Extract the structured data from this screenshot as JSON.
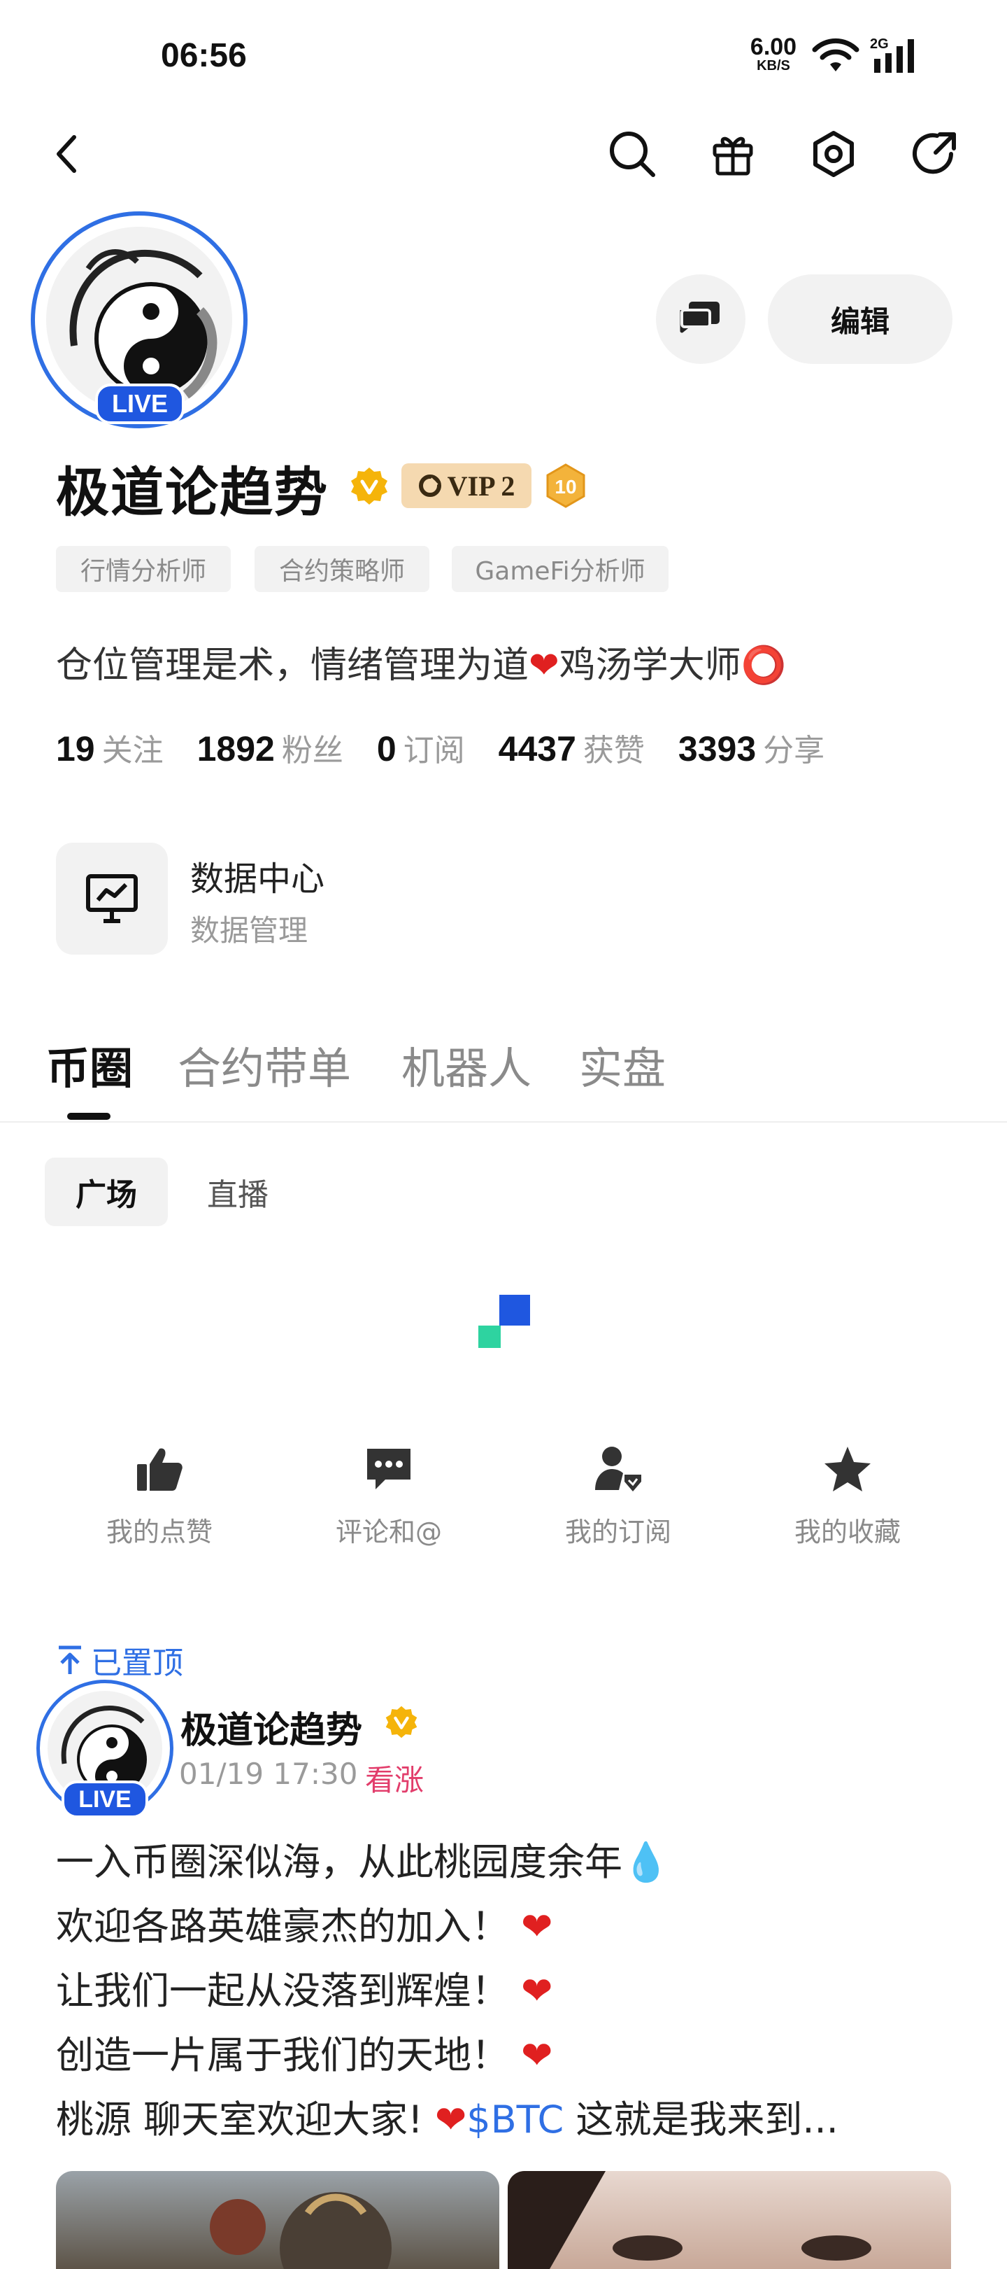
{
  "status_bar": {
    "time": "06:56",
    "net_speed_value": "6.00",
    "net_speed_unit": "KB/S",
    "network_type": "2G"
  },
  "header": {
    "icons": [
      "back-icon",
      "search-icon",
      "gift-icon",
      "settings-hex-icon",
      "share-refresh-icon"
    ]
  },
  "profile": {
    "live_label": "LIVE",
    "edit_label": "编辑",
    "name": "极道论趋势",
    "vip_label": "VIP 2",
    "level": "10",
    "tags": [
      "行情分析师",
      "合约策略师",
      "GameFi分析师"
    ],
    "bio_part1": "仓位管理是术，情绪管理为道",
    "bio_part2": "鸡汤学大师",
    "stats": [
      {
        "value": "19",
        "label": "关注"
      },
      {
        "value": "1892",
        "label": "粉丝"
      },
      {
        "value": "0",
        "label": "订阅"
      },
      {
        "value": "4437",
        "label": "获赞"
      },
      {
        "value": "3393",
        "label": "分享"
      }
    ],
    "colors": {
      "accent": "#2f6fe4",
      "verified": "#f5b40a",
      "vip_bg": "#f5d9b0",
      "bullish": "#e23d6b"
    }
  },
  "data_center": {
    "title": "数据中心",
    "subtitle": "数据管理"
  },
  "tabs": [
    "币圈",
    "合约带单",
    "机器人",
    "实盘"
  ],
  "subtabs": [
    "广场",
    "直播"
  ],
  "quick_actions": [
    {
      "label": "我的点赞",
      "icon": "thumbs-up-icon"
    },
    {
      "label": "评论和@",
      "icon": "comment-icon"
    },
    {
      "label": "我的订阅",
      "icon": "subscribe-user-icon"
    },
    {
      "label": "我的收藏",
      "icon": "star-icon"
    }
  ],
  "post": {
    "pinned_label": "已置顶",
    "author": "极道论趋势",
    "live_label": "LIVE",
    "time": "01/19 17:30",
    "sentiment": "看涨",
    "line1": "一入币圈深似海，从此桃园度余年",
    "line2": "欢迎各路英雄豪杰的加入！",
    "line3": "让我们一起从没落到辉煌！",
    "line4": "创造一片属于我们的天地！",
    "line5_a": "桃源 聊天室欢迎大家!",
    "line5_ticker": "$BTC",
    "line5_b": " 这就是我来到..."
  }
}
